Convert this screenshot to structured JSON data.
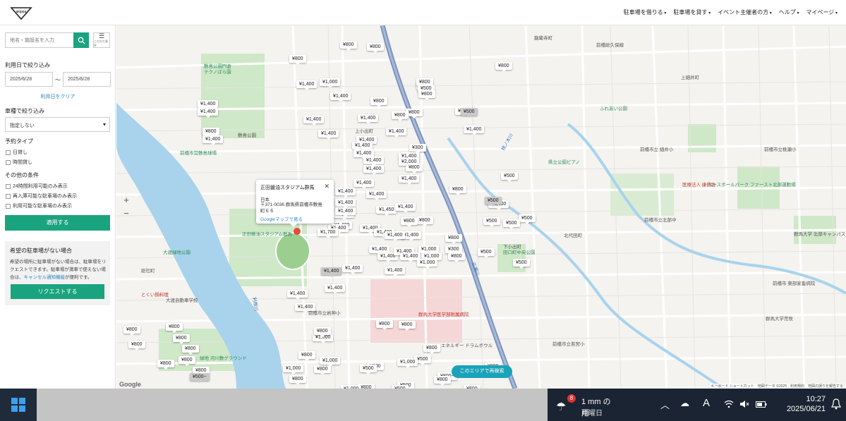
{
  "header": {
    "logo": "akippa",
    "nav": [
      "駐車場を借りる",
      "駐車場を貸す",
      "イベント主催者の方",
      "ヘルプ",
      "マイページ"
    ]
  },
  "sidebar": {
    "search_placeholder": "地名・施設名を入力",
    "filter_button_label": "こだわり条件",
    "date_title": "利用日で絞り込み",
    "date_start": "2025/6/28",
    "date_sep": "～",
    "date_end": "2025/6/28",
    "clear_date": "利用日をクリア",
    "car_title": "車種で絞り込み",
    "car_value": "指定しない",
    "reserve_title": "予約タイプ",
    "reserve_types": [
      "日貸し",
      "時間貸し"
    ],
    "other_title": "その他の条件",
    "other_options": [
      "24時間利用可能のみ表示",
      "再入庫可能な駐車場のみ表示",
      "利用可能な駐車場のみ表示"
    ],
    "apply": "適用する",
    "request_title": "希望の駐車場がない場合",
    "request_text_1": "希望の場所に駐車場がない場合は、駐車場をリクエストできます。駐車場が満車で使えない場合は、",
    "request_link": "キャンセル通知機能",
    "request_text_2": "が便利です。",
    "request_button": "リクエストする"
  },
  "map": {
    "popup": {
      "title": "正田醤油スタジアム群馬",
      "close": "✕",
      "country": "日本",
      "address": "〒371-0036 群馬県前橋市敷島町６６",
      "gmaps": "Googleマップで見る"
    },
    "zoom_in": "+",
    "zoom_out": "−",
    "area_search": "このエリアで再検索",
    "google": "Google",
    "copyright": "キーボード ショートカット　地図データ ©2025　利用規約　地図の誤りを報告する",
    "labels": [
      {
        "t": "敷島公園門倉",
        "k": "g"
      },
      {
        "t": "テクノばら園",
        "k": "g"
      },
      {
        "t": "敷島公園",
        "k": "g"
      },
      {
        "t": "前橋市営敷島球場",
        "k": "g"
      },
      {
        "t": "正田醤油スタジアム群馬",
        "k": "g"
      },
      {
        "t": "大渡緑地公園",
        "k": "g"
      },
      {
        "t": "総社町",
        "k": "m"
      },
      {
        "t": "大渡自動車学校",
        "k": "m"
      },
      {
        "t": "とくい鍋料理",
        "k": "r"
      },
      {
        "t": "緑地 河川敷グラウンド",
        "k": "g"
      },
      {
        "t": "前橋市立岩神小",
        "k": "m"
      },
      {
        "t": "群馬大学医学部附属病院",
        "k": "r"
      },
      {
        "t": "エネルギー ドラムボウル",
        "k": "m"
      },
      {
        "t": "龍蔵寺町",
        "k": "m"
      },
      {
        "t": "前橋総久保線",
        "k": "m"
      },
      {
        "t": "上細井町",
        "k": "m"
      },
      {
        "t": "ふれあい公園",
        "k": "g"
      },
      {
        "t": "前橋市立 細井小",
        "k": "m"
      },
      {
        "t": "前橋市立桃瀬小",
        "k": "m"
      },
      {
        "t": "県立公園ピアノ",
        "k": "g"
      },
      {
        "t": "医療法人 康償会",
        "k": "r"
      },
      {
        "t": "ベースボールパーク ファースト北部運動場",
        "k": "g"
      },
      {
        "t": "前橋市立北部中",
        "k": "m"
      },
      {
        "t": "北代田町",
        "k": "m"
      },
      {
        "t": "上小出町",
        "k": "m"
      },
      {
        "t": "下小出町",
        "k": "m"
      },
      {
        "t": "田口町中央公園",
        "k": "g"
      },
      {
        "t": "前橋市立若宮小",
        "k": "m"
      },
      {
        "t": "前橋市 東部家畜病院",
        "k": "m"
      },
      {
        "t": "群馬大学荒牧",
        "k": "m"
      },
      {
        "t": "群馬大学 北部キャンパス",
        "k": "m"
      },
      {
        "t": "利根川",
        "k": "b"
      },
      {
        "t": "広瀬川",
        "k": "b"
      },
      {
        "t": "桃ノ木川",
        "k": "b"
      }
    ],
    "pins": [
      {
        "p": "¥800",
        "g": false
      },
      {
        "p": "¥800",
        "g": false
      },
      {
        "p": "¥800",
        "g": false
      },
      {
        "p": "¥800",
        "g": false
      },
      {
        "p": "¥500",
        "g": false
      },
      {
        "p": "¥1,400",
        "g": false
      },
      {
        "p": "¥1,000",
        "g": false
      },
      {
        "p": "¥800",
        "g": false
      },
      {
        "p": "¥500",
        "g": false
      },
      {
        "p": "¥1,400",
        "g": false
      },
      {
        "p": "¥800",
        "g": false
      },
      {
        "p": "¥800",
        "g": false
      },
      {
        "p": "¥1,400",
        "g": false
      },
      {
        "p": "¥1,400",
        "g": false
      },
      {
        "p": "¥800",
        "g": false
      },
      {
        "p": "¥800",
        "g": false
      },
      {
        "p": "¥500",
        "g": true
      },
      {
        "p": "¥1,400",
        "g": false
      },
      {
        "p": "¥1,400",
        "g": false
      },
      {
        "p": "¥800",
        "g": false
      },
      {
        "p": "¥800",
        "g": false
      },
      {
        "p": "¥1,400",
        "g": false
      },
      {
        "p": "¥1,400",
        "g": false
      },
      {
        "p": "¥1,400",
        "g": false
      },
      {
        "p": "¥1,400",
        "g": false
      },
      {
        "p": "¥1,400",
        "g": false
      },
      {
        "p": "¥1,400",
        "g": false
      },
      {
        "p": "¥300",
        "g": false
      },
      {
        "p": "¥1,400",
        "g": false
      },
      {
        "p": "¥1,400",
        "g": false
      },
      {
        "p": "¥2,000",
        "g": false
      },
      {
        "p": "¥1,400",
        "g": false
      },
      {
        "p": "¥800",
        "g": false
      },
      {
        "p": "¥500",
        "g": false
      },
      {
        "p": "¥1,400",
        "g": false
      },
      {
        "p": "¥1,400",
        "g": false
      },
      {
        "p": "¥1,400",
        "g": false
      },
      {
        "p": "¥800",
        "g": false
      },
      {
        "p": "¥1,400",
        "g": false
      },
      {
        "p": "¥1,400",
        "g": false
      },
      {
        "p": "¥1,400",
        "g": false
      },
      {
        "p": "¥1,400",
        "g": false
      },
      {
        "p": "¥1,450",
        "g": false
      },
      {
        "p": "¥1,400",
        "g": false
      },
      {
        "p": "¥1,400",
        "g": false
      },
      {
        "p": "¥800",
        "g": false
      },
      {
        "p": "¥1,400",
        "g": false
      },
      {
        "p": "¥1,400",
        "g": false
      },
      {
        "p": "¥1,400",
        "g": false
      },
      {
        "p": "¥500",
        "g": true
      },
      {
        "p": "¥1,400",
        "g": false
      },
      {
        "p": "¥1,400",
        "g": false
      },
      {
        "p": "¥800",
        "g": false
      },
      {
        "p": "¥500",
        "g": false
      },
      {
        "p": "¥500",
        "g": false
      },
      {
        "p": "¥500",
        "g": false
      },
      {
        "p": "¥1,700",
        "g": false
      },
      {
        "p": "¥1,400",
        "g": false
      },
      {
        "p": "¥1,400",
        "g": false
      },
      {
        "p": "¥800",
        "g": false
      },
      {
        "p": "¥1,400",
        "g": false
      },
      {
        "p": "¥1,000",
        "g": false
      },
      {
        "p": "¥300",
        "g": false
      },
      {
        "p": "¥500",
        "g": false
      },
      {
        "p": "¥1,400",
        "g": false
      },
      {
        "p": "¥1,400",
        "g": false
      },
      {
        "p": "¥1,400",
        "g": false
      },
      {
        "p": "¥1,000",
        "g": false
      },
      {
        "p": "¥800",
        "g": false
      },
      {
        "p": "¥1,000",
        "g": false
      },
      {
        "p": "¥500",
        "g": false
      },
      {
        "p": "¥1,400",
        "g": true
      },
      {
        "p": "¥1,400",
        "g": false
      },
      {
        "p": "¥1,400",
        "g": false
      },
      {
        "p": "¥1,400",
        "g": false
      },
      {
        "p": "¥1,400",
        "g": false
      },
      {
        "p": "¥1,400",
        "g": false
      },
      {
        "p": "¥1,000",
        "g": false
      },
      {
        "p": "¥800",
        "g": false
      },
      {
        "p": "¥800",
        "g": false
      },
      {
        "p": "¥800",
        "g": false
      },
      {
        "p": "¥800",
        "g": false
      },
      {
        "p": "¥800",
        "g": false
      },
      {
        "p": "¥800",
        "g": false
      },
      {
        "p": "¥800",
        "g": false
      },
      {
        "p": "¥800",
        "g": false
      },
      {
        "p": "¥800",
        "g": false
      },
      {
        "p": "¥800",
        "g": false
      },
      {
        "p": "¥800",
        "g": false
      },
      {
        "p": "¥500~",
        "g": true
      },
      {
        "p": "¥800",
        "g": false
      },
      {
        "p": "¥800",
        "g": false
      },
      {
        "p": "¥1,000",
        "g": false
      },
      {
        "p": "¥800",
        "g": false
      },
      {
        "p": "¥800",
        "g": false
      },
      {
        "p": "¥500",
        "g": false
      },
      {
        "p": "¥1,000",
        "g": false
      },
      {
        "p": "¥500",
        "g": false
      },
      {
        "p": "¥800~",
        "g": false
      },
      {
        "p": "¥1,000",
        "g": false
      },
      {
        "p": "¥800",
        "g": false
      },
      {
        "p": "¥800",
        "g": false
      },
      {
        "p": "¥1,000",
        "g": false
      },
      {
        "p": "¥500",
        "g": false
      },
      {
        "p": "¥500",
        "g": false
      },
      {
        "p": "¥800",
        "g": false
      },
      {
        "p": "¥800",
        "g": false
      },
      {
        "p": "¥800",
        "g": false
      }
    ]
  },
  "taskbar": {
    "weather_badge": "8",
    "weather_main": "1 mm の雨",
    "weather_sub": "月曜日",
    "ime": "A",
    "time": "10:27",
    "date": "2025/06/21"
  },
  "colors": {
    "accent": "#1aa37f",
    "link": "#2a84c5",
    "area_button": "#1aa3b8"
  }
}
